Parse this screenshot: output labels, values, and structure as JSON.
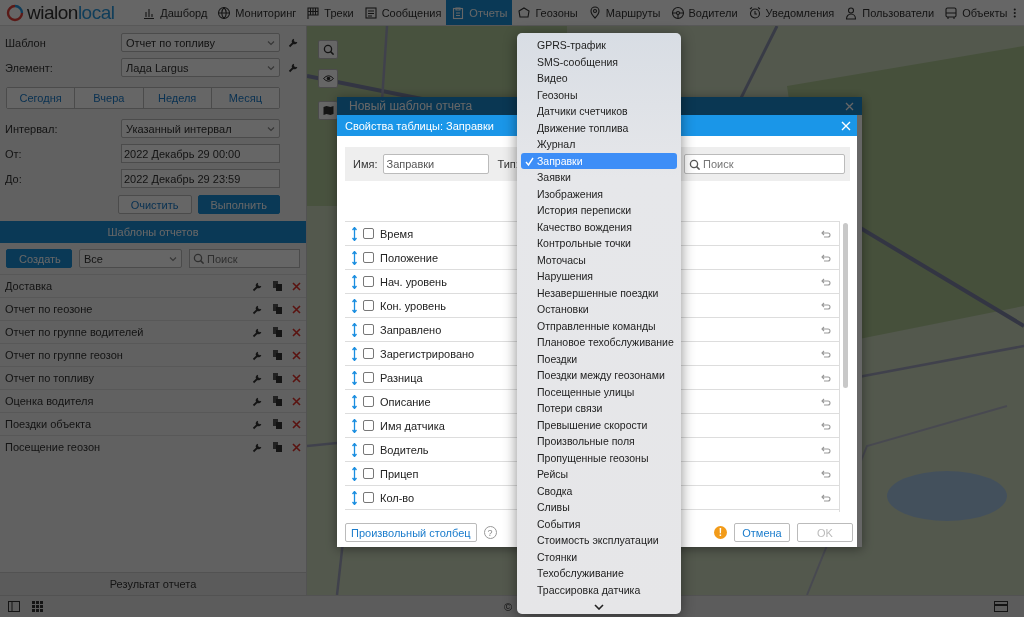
{
  "topbar": {
    "logo": [
      "wialon",
      "local"
    ],
    "nav": [
      {
        "label": "Дашборд",
        "selected": false
      },
      {
        "label": "Мониторинг",
        "selected": false
      },
      {
        "label": "Треки",
        "selected": false
      },
      {
        "label": "Сообщения",
        "selected": false
      },
      {
        "label": "Отчеты",
        "selected": true
      },
      {
        "label": "Геозоны",
        "selected": false
      },
      {
        "label": "Маршруты",
        "selected": false
      },
      {
        "label": "Водители",
        "selected": false
      },
      {
        "label": "Уведомления",
        "selected": false
      },
      {
        "label": "Пользователи",
        "selected": false
      },
      {
        "label": "Объекты",
        "selected": false
      }
    ]
  },
  "report_form": {
    "template_label": "Шаблон",
    "template_value": "Отчет по топливу",
    "element_label": "Элемент:",
    "element_value": "Лада Largus",
    "quick_ranges": [
      "Сегодня",
      "Вчера",
      "Неделя",
      "Месяц"
    ],
    "interval_label": "Интервал:",
    "interval_value": "Указанный интервал",
    "from_label": "От:",
    "from_value": "2022 Декабрь 29 00:00",
    "to_label": "До:",
    "to_value": "2022 Декабрь 29 23:59",
    "clear_button": "Очистить",
    "run_button": "Выполнить"
  },
  "templates": {
    "title": "Шаблоны отчетов",
    "create_button": "Создать",
    "filter_value": "Все",
    "search_placeholder": "Поиск",
    "items": [
      "Доставка",
      "Отчет по геозоне",
      "Отчет по группе водителей",
      "Отчет по группе геозон",
      "Отчет по топливу",
      "Оценка водителя",
      "Поездки объекта",
      "Посещение геозон"
    ]
  },
  "result_bar": "Результат отчета",
  "footer_text": "©",
  "outer_dialog": {
    "title": "Новый шаблон отчета"
  },
  "dialog": {
    "title": "Свойства таблицы: Заправки",
    "name_label": "Имя:",
    "name_value": "Заправки",
    "type_label": "Тип:",
    "search_placeholder": "Поиск",
    "columns": [
      {
        "label": "Время",
        "checked": false
      },
      {
        "label": "Положение",
        "checked": false
      },
      {
        "label": "Нач. уровень",
        "checked": false
      },
      {
        "label": "Кон. уровень",
        "checked": false
      },
      {
        "label": "Заправлено",
        "checked": false
      },
      {
        "label": "Зарегистрировано",
        "checked": false
      },
      {
        "label": "Разница",
        "checked": false
      },
      {
        "label": "Описание",
        "checked": false
      },
      {
        "label": "Имя датчика",
        "checked": false
      },
      {
        "label": "Водитель",
        "checked": false
      },
      {
        "label": "Прицеп",
        "checked": false
      },
      {
        "label": "Кол-во",
        "checked": false
      }
    ],
    "custom_column_button": "Произвольный столбец",
    "help": "?",
    "warning": "!",
    "cancel_button": "Отмена",
    "ok_button": {
      "label": "OK",
      "disabled": true
    }
  },
  "type_dropdown": {
    "options": [
      {
        "label": "GPRS-трафик",
        "selected": false
      },
      {
        "label": "SMS-сообщения",
        "selected": false
      },
      {
        "label": "Видео",
        "selected": false
      },
      {
        "label": "Геозоны",
        "selected": false
      },
      {
        "label": "Датчики счетчиков",
        "selected": false
      },
      {
        "label": "Движение топлива",
        "selected": false
      },
      {
        "label": "Журнал",
        "selected": false
      },
      {
        "label": "Заправки",
        "selected": true
      },
      {
        "label": "Заявки",
        "selected": false
      },
      {
        "label": "Изображения",
        "selected": false
      },
      {
        "label": "История переписки",
        "selected": false
      },
      {
        "label": "Качество вождения",
        "selected": false
      },
      {
        "label": "Контрольные точки",
        "selected": false
      },
      {
        "label": "Моточасы",
        "selected": false
      },
      {
        "label": "Нарушения",
        "selected": false
      },
      {
        "label": "Незавершенные поездки",
        "selected": false
      },
      {
        "label": "Остановки",
        "selected": false
      },
      {
        "label": "Отправленные команды",
        "selected": false
      },
      {
        "label": "Плановое техобслуживание",
        "selected": false
      },
      {
        "label": "Поездки",
        "selected": false
      },
      {
        "label": "Поездки между геозонами",
        "selected": false
      },
      {
        "label": "Посещенные улицы",
        "selected": false
      },
      {
        "label": "Потери связи",
        "selected": false
      },
      {
        "label": "Превышение скорости",
        "selected": false
      },
      {
        "label": "Произвольные поля",
        "selected": false
      },
      {
        "label": "Пропущенные геозоны",
        "selected": false
      },
      {
        "label": "Рейсы",
        "selected": false
      },
      {
        "label": "Сводка",
        "selected": false
      },
      {
        "label": "Сливы",
        "selected": false
      },
      {
        "label": "События",
        "selected": false
      },
      {
        "label": "Стоимость эксплуатации",
        "selected": false
      },
      {
        "label": "Стоянки",
        "selected": false
      },
      {
        "label": "Техобслуживание",
        "selected": false
      },
      {
        "label": "Трассировка датчика",
        "selected": false
      }
    ]
  }
}
